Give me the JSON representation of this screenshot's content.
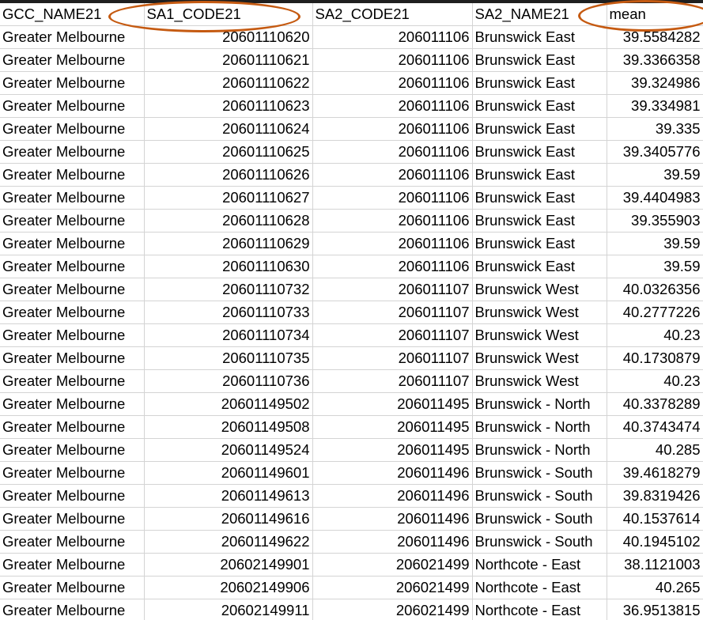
{
  "columns": [
    "GCC_NAME21",
    "SA1_CODE21",
    "SA2_CODE21",
    "SA2_NAME21",
    "mean"
  ],
  "rows": [
    [
      "Greater Melbourne",
      "20601110620",
      "206011106",
      "Brunswick East",
      "39.5584282"
    ],
    [
      "Greater Melbourne",
      "20601110621",
      "206011106",
      "Brunswick East",
      "39.3366358"
    ],
    [
      "Greater Melbourne",
      "20601110622",
      "206011106",
      "Brunswick East",
      "39.324986"
    ],
    [
      "Greater Melbourne",
      "20601110623",
      "206011106",
      "Brunswick East",
      "39.334981"
    ],
    [
      "Greater Melbourne",
      "20601110624",
      "206011106",
      "Brunswick East",
      "39.335"
    ],
    [
      "Greater Melbourne",
      "20601110625",
      "206011106",
      "Brunswick East",
      "39.3405776"
    ],
    [
      "Greater Melbourne",
      "20601110626",
      "206011106",
      "Brunswick East",
      "39.59"
    ],
    [
      "Greater Melbourne",
      "20601110627",
      "206011106",
      "Brunswick East",
      "39.4404983"
    ],
    [
      "Greater Melbourne",
      "20601110628",
      "206011106",
      "Brunswick East",
      "39.355903"
    ],
    [
      "Greater Melbourne",
      "20601110629",
      "206011106",
      "Brunswick East",
      "39.59"
    ],
    [
      "Greater Melbourne",
      "20601110630",
      "206011106",
      "Brunswick East",
      "39.59"
    ],
    [
      "Greater Melbourne",
      "20601110732",
      "206011107",
      "Brunswick West",
      "40.0326356"
    ],
    [
      "Greater Melbourne",
      "20601110733",
      "206011107",
      "Brunswick West",
      "40.2777226"
    ],
    [
      "Greater Melbourne",
      "20601110734",
      "206011107",
      "Brunswick West",
      "40.23"
    ],
    [
      "Greater Melbourne",
      "20601110735",
      "206011107",
      "Brunswick West",
      "40.1730879"
    ],
    [
      "Greater Melbourne",
      "20601110736",
      "206011107",
      "Brunswick West",
      "40.23"
    ],
    [
      "Greater Melbourne",
      "20601149502",
      "206011495",
      "Brunswick - North",
      "40.3378289"
    ],
    [
      "Greater Melbourne",
      "20601149508",
      "206011495",
      "Brunswick - North",
      "40.3743474"
    ],
    [
      "Greater Melbourne",
      "20601149524",
      "206011495",
      "Brunswick - North",
      "40.285"
    ],
    [
      "Greater Melbourne",
      "20601149601",
      "206011496",
      "Brunswick - South",
      "39.4618279"
    ],
    [
      "Greater Melbourne",
      "20601149613",
      "206011496",
      "Brunswick - South",
      "39.8319426"
    ],
    [
      "Greater Melbourne",
      "20601149616",
      "206011496",
      "Brunswick - South",
      "40.1537614"
    ],
    [
      "Greater Melbourne",
      "20601149622",
      "206011496",
      "Brunswick - South",
      "40.1945102"
    ],
    [
      "Greater Melbourne",
      "20602149901",
      "206021499",
      "Northcote - East",
      "38.1121003"
    ],
    [
      "Greater Melbourne",
      "20602149906",
      "206021499",
      "Northcote - East",
      "40.265"
    ],
    [
      "Greater Melbourne",
      "20602149911",
      "206021499",
      "Northcote - East",
      "36.9513815"
    ]
  ],
  "highlight_color": "#c55a11",
  "highlighted_columns": [
    "SA1_CODE21",
    "mean"
  ]
}
